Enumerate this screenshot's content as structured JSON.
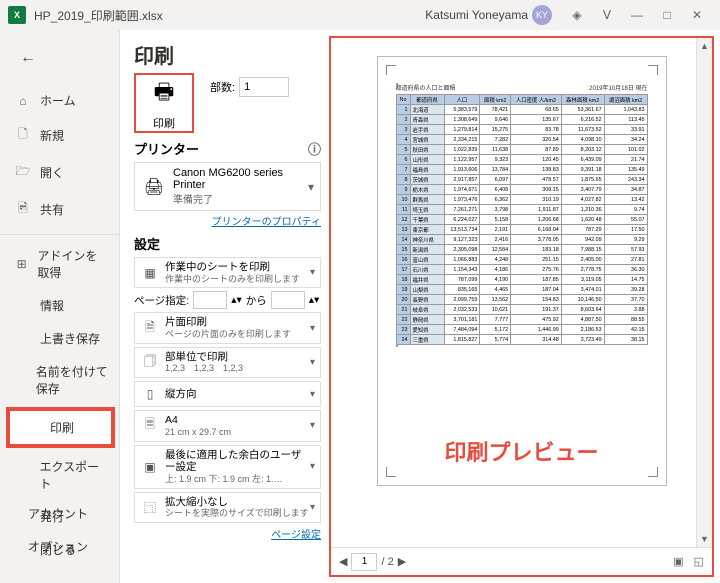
{
  "titlebar": {
    "app": "X",
    "file_name": "HP_2019_印刷範囲.xlsx",
    "user_name": "Katsumi Yoneyama",
    "user_initials": "KY"
  },
  "sidebar": {
    "items": [
      {
        "icon": "⌂",
        "label": "ホーム"
      },
      {
        "icon": "🗋",
        "label": "新規"
      },
      {
        "icon": "🗁",
        "label": "開く"
      },
      {
        "icon": "🖻",
        "label": "共有"
      },
      {
        "icon": "⊞",
        "label": "アドインを取得"
      },
      {
        "icon": "",
        "label": "情報"
      },
      {
        "icon": "",
        "label": "上書き保存"
      },
      {
        "icon": "",
        "label": "名前を付けて保存"
      },
      {
        "icon": "",
        "label": "印刷"
      },
      {
        "icon": "",
        "label": "エクスポート"
      },
      {
        "icon": "",
        "label": "発行"
      },
      {
        "icon": "",
        "label": "閉じる"
      }
    ],
    "bottom": [
      {
        "label": "アカウント"
      },
      {
        "label": "オプション"
      }
    ]
  },
  "print": {
    "heading": "印刷",
    "print_label": "印刷",
    "copies_label": "部数:",
    "copies_value": "1",
    "printer_section": "プリンター",
    "printer_name": "Canon MG6200 series Printer",
    "printer_status": "準備完了",
    "printer_props": "プリンターのプロパティ",
    "settings_section": "設定",
    "settings": [
      {
        "main": "作業中のシートを印刷",
        "desc": "作業中のシートのみを印刷します"
      },
      {
        "main": "片面印刷",
        "desc": "ページの片面のみを印刷します"
      },
      {
        "main": "部単位で印刷",
        "desc": "1,2,3　1,2,3　1,2,3"
      },
      {
        "main": "縦方向",
        "desc": ""
      },
      {
        "main": "A4",
        "desc": "21 cm x 29.7 cm"
      },
      {
        "main": "最後に適用した余白のユーザー設定",
        "desc": "上: 1.9 cm 下: 1.9 cm 左: 1.…"
      },
      {
        "main": "拡大縮小なし",
        "desc": "シートを実際のサイズで印刷します"
      }
    ],
    "page_spec_label": "ページ指定:",
    "page_spec_to": "から",
    "page_setup": "ページ設定"
  },
  "preview": {
    "sheet_title": "都道府県の人口と面積",
    "sheet_date": "2019年10月18日 現在",
    "headers": [
      "No",
      "都道府県",
      "人口",
      "面積 km2",
      "人口密度 人/km2",
      "森林面積 km2",
      "湖沼面積 km2"
    ],
    "preview_label": "印刷プレビュー",
    "page_current": "1",
    "page_total": "/ 2"
  },
  "chart_data": {
    "type": "table",
    "title": "都道府県の人口と面積",
    "columns": [
      "No",
      "都道府県",
      "人口",
      "面積 km2",
      "人口密度 人/km2",
      "森林面積 km2",
      "湖沼面積 km2"
    ],
    "rows": [
      [
        1,
        "北海道",
        "5,383,579",
        "78,421",
        "68.65",
        "53,361.67",
        "1,043.83"
      ],
      [
        2,
        "青森県",
        "1,308,649",
        "9,646",
        "135.67",
        "6,216.52",
        "113.45"
      ],
      [
        3,
        "岩手県",
        "1,279,814",
        "15,275",
        "83.78",
        "11,673.52",
        "33.91"
      ],
      [
        4,
        "宮城県",
        "2,334,215",
        "7,282",
        "320.54",
        "4,098.10",
        "34.24"
      ],
      [
        5,
        "秋田県",
        "1,022,839",
        "11,638",
        "87.89",
        "8,203.12",
        "101.02"
      ],
      [
        6,
        "山形県",
        "1,122,957",
        "9,323",
        "120.45",
        "6,439.09",
        "21.74"
      ],
      [
        7,
        "福島県",
        "1,913,606",
        "13,784",
        "138.83",
        "9,391.18",
        "135.49"
      ],
      [
        8,
        "茨城県",
        "2,917,857",
        "6,097",
        "478.57",
        "1,875.65",
        "243.34"
      ],
      [
        9,
        "栃木県",
        "1,974,671",
        "6,408",
        "308.15",
        "3,407.79",
        "34.87"
      ],
      [
        10,
        "群馬県",
        "1,973,476",
        "6,362",
        "310.19",
        "4,027.82",
        "13.42"
      ],
      [
        11,
        "埼玉県",
        "7,261,271",
        "3,798",
        "1,911.87",
        "1,210.36",
        "9.74"
      ],
      [
        12,
        "千葉県",
        "6,224,027",
        "5,158",
        "1,206.68",
        "1,620.48",
        "55.07"
      ],
      [
        13,
        "東京都",
        "13,513,734",
        "2,191",
        "6,168.04",
        "787.29",
        "17.50"
      ],
      [
        14,
        "神奈川県",
        "9,127,323",
        "2,416",
        "3,778.05",
        "942.09",
        "9.29"
      ],
      [
        15,
        "新潟県",
        "2,305,098",
        "12,584",
        "183.18",
        "7,988.15",
        "57.93"
      ],
      [
        16,
        "富山県",
        "1,066,883",
        "4,248",
        "251.15",
        "2,405.00",
        "27.81"
      ],
      [
        17,
        "石川県",
        "1,154,343",
        "4,186",
        "275.76",
        "2,778.75",
        "36.30"
      ],
      [
        18,
        "福井県",
        "787,099",
        "4,190",
        "187.85",
        "3,119.05",
        "14.75"
      ],
      [
        19,
        "山梨県",
        "835,165",
        "4,465",
        "187.04",
        "3,474.01",
        "39.28"
      ],
      [
        20,
        "長野県",
        "2,099,759",
        "13,562",
        "154.83",
        "10,146.50",
        "37.70"
      ],
      [
        21,
        "岐阜県",
        "2,032,533",
        "10,621",
        "191.37",
        "8,603.64",
        "3.88"
      ],
      [
        22,
        "静岡県",
        "3,701,181",
        "7,777",
        "475.92",
        "4,887.50",
        "88.55"
      ],
      [
        23,
        "愛知県",
        "7,484,094",
        "5,172",
        "1,446.99",
        "2,186.53",
        "42.15"
      ],
      [
        24,
        "三重県",
        "1,815,827",
        "5,774",
        "314.48",
        "3,723.49",
        "38.15"
      ]
    ]
  }
}
